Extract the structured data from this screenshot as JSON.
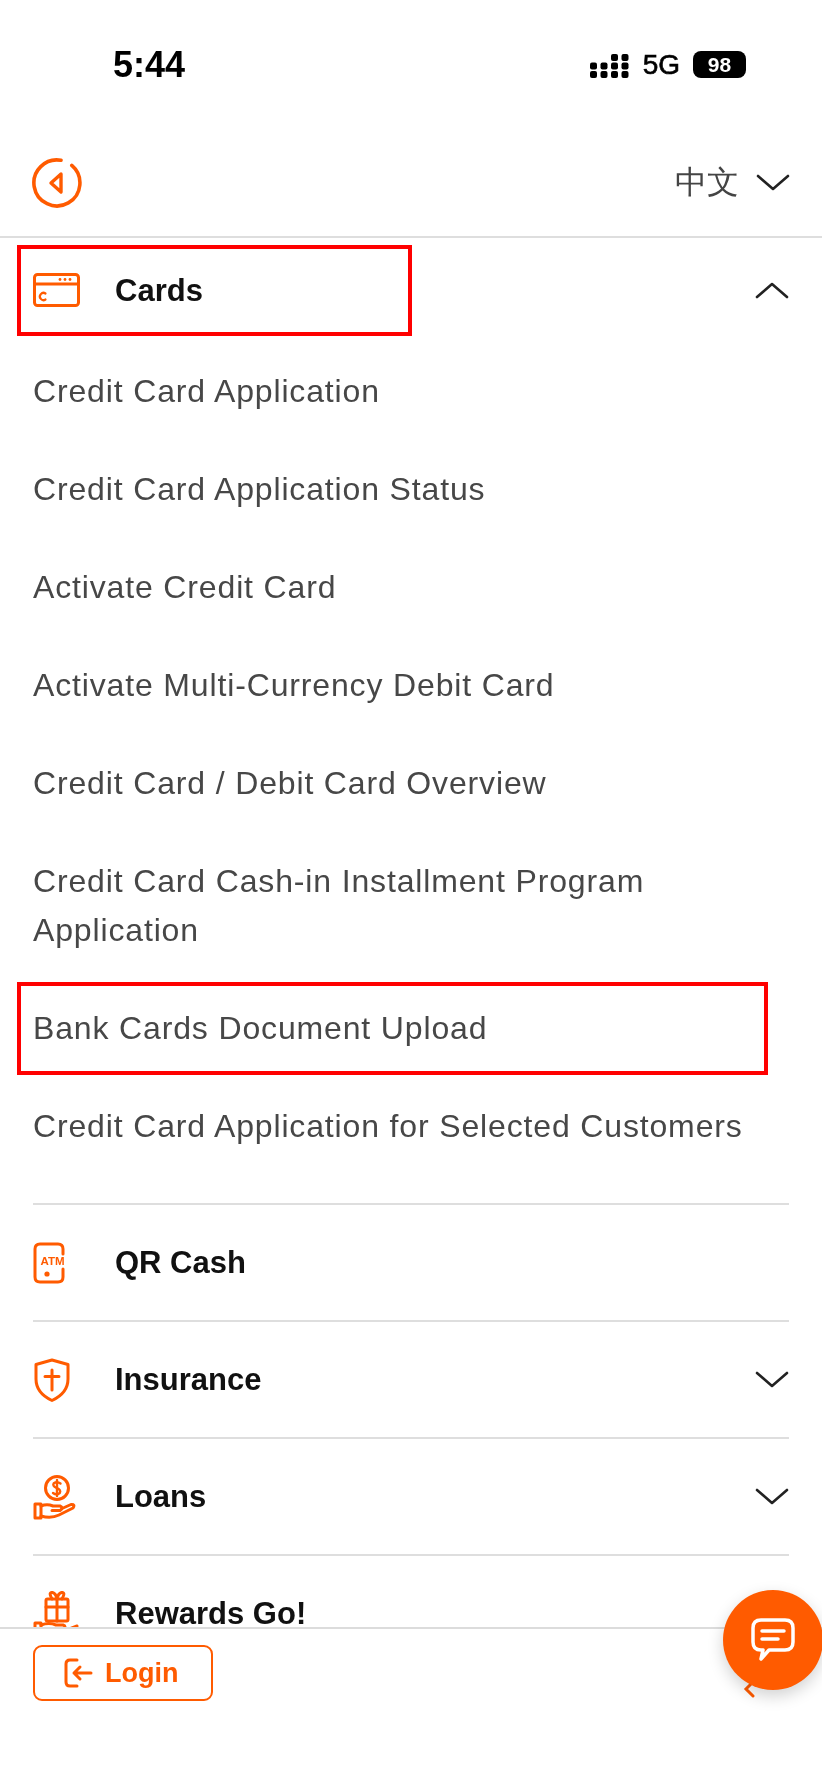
{
  "status_bar": {
    "time": "5:44",
    "network": "5G",
    "battery": "98"
  },
  "header": {
    "language": "中文"
  },
  "menu": [
    {
      "label": "Cards",
      "highlighted": true,
      "expanded": true,
      "children": [
        {
          "label": "Credit Card Application",
          "highlighted": false
        },
        {
          "label": "Credit Card Application Status",
          "highlighted": false
        },
        {
          "label": "Activate Credit Card",
          "highlighted": false
        },
        {
          "label": "Activate Multi-Currency Debit Card",
          "highlighted": false
        },
        {
          "label": "Credit Card / Debit Card Overview",
          "highlighted": false
        },
        {
          "label": "Credit Card Cash-in Installment Program Application",
          "highlighted": false
        },
        {
          "label": "Bank Cards Document Upload",
          "highlighted": true
        },
        {
          "label": "Credit Card Application for Selected Customers",
          "highlighted": false
        }
      ]
    },
    {
      "label": "QR Cash",
      "highlighted": false,
      "icon_text": "ATM"
    },
    {
      "label": "Insurance",
      "highlighted": false,
      "expanded": false
    },
    {
      "label": "Loans",
      "highlighted": false,
      "expanded": false
    },
    {
      "label": "Rewards Go!",
      "highlighted": false
    }
  ],
  "login_button": {
    "label": "Login"
  }
}
